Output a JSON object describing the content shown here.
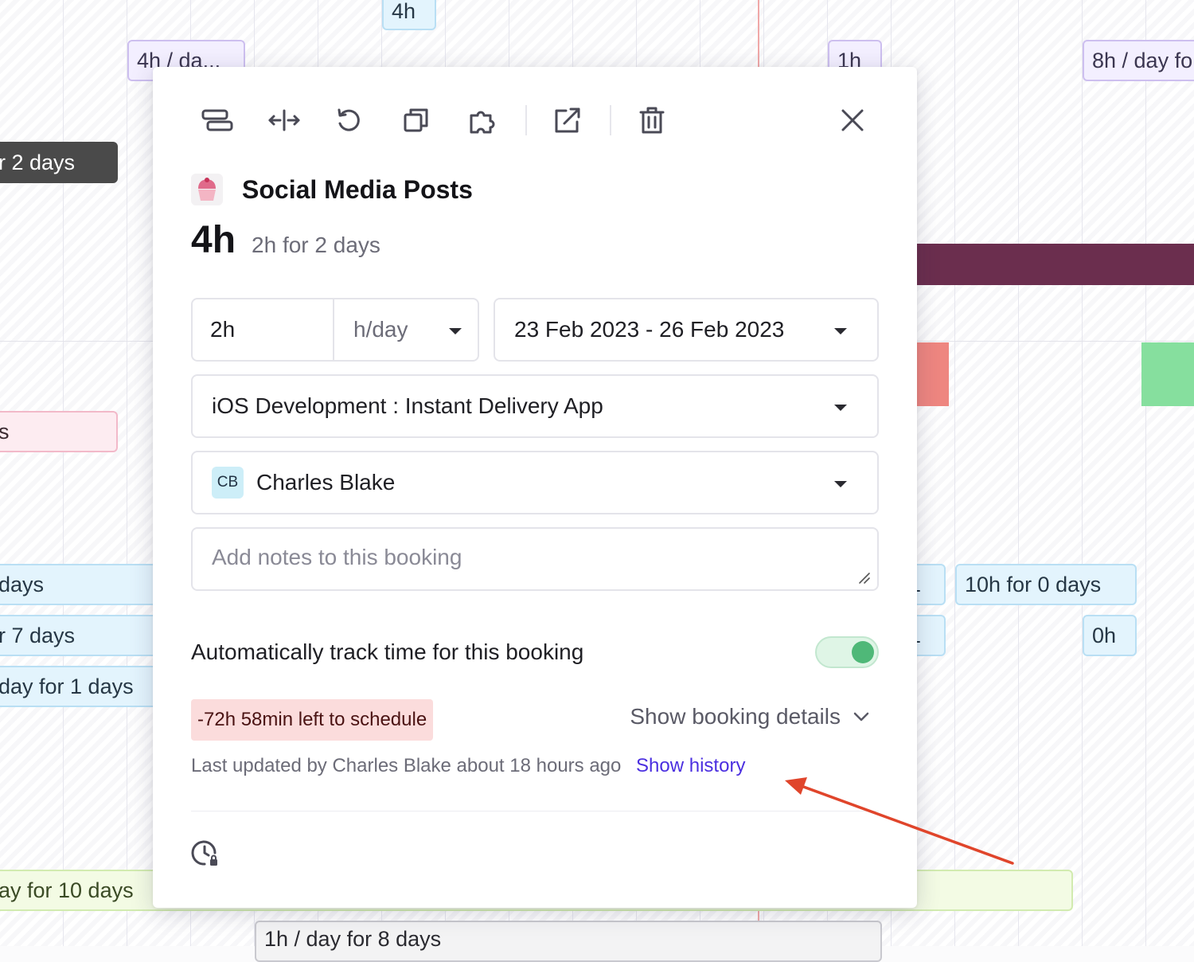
{
  "background_chips": [
    {
      "id": "c1",
      "text": "4h"
    },
    {
      "id": "c2",
      "text": "4h / da..."
    },
    {
      "id": "c3",
      "text": "1h"
    },
    {
      "id": "c4",
      "text": "8h / day fo"
    },
    {
      "id": "c5",
      "text": "r 2 days"
    },
    {
      "id": "c6",
      "text": "s"
    },
    {
      "id": "c7",
      "text": "days"
    },
    {
      "id": "c8",
      "text": "r 7 days"
    },
    {
      "id": "c9",
      "text": "day for 1 days"
    },
    {
      "id": "c10",
      "text": "1"
    },
    {
      "id": "c11",
      "text": "10h for 0 days"
    },
    {
      "id": "c12",
      "text": "1"
    },
    {
      "id": "c13",
      "text": "0h"
    },
    {
      "id": "c14",
      "text": "ay for 10 days"
    },
    {
      "id": "c15",
      "text": "1h / day for 8 days"
    }
  ],
  "toolbar": {
    "items": [
      {
        "name": "split-booking",
        "icon": "split-icon"
      },
      {
        "name": "resize-booking",
        "icon": "arrows-horizontal-icon"
      },
      {
        "name": "repeat-booking",
        "icon": "rotate-icon"
      },
      {
        "name": "duplicate-booking",
        "icon": "copy-icon"
      },
      {
        "name": "integration",
        "icon": "puzzle-icon"
      },
      {
        "name": "open-external",
        "icon": "external-link-icon"
      },
      {
        "name": "delete-booking",
        "icon": "trash-icon"
      }
    ],
    "close_icon": "close-icon"
  },
  "booking": {
    "project_icon": "cupcake-icon",
    "title": "Social Media Posts",
    "total_hours": "4h",
    "summary": "2h for 2 days",
    "hours_per_day_value": "2h",
    "hours_unit": "h/day",
    "date_range": "23 Feb 2023 - 26 Feb 2023",
    "project": "iOS Development : Instant Delivery App",
    "assignee_initials": "CB",
    "assignee_name": "Charles Blake",
    "notes_placeholder": "Add notes to this booking",
    "track_label": "Automatically track time for this booking",
    "track_enabled": true,
    "left_to_schedule": "-72h 58min left to schedule",
    "show_details_label": "Show booking details",
    "last_updated": "Last updated by Charles Blake about 18 hours ago",
    "show_history_label": "Show history"
  },
  "colors": {
    "accent_link": "#4b2fe0",
    "toggle_on": "#4fb878",
    "warning_bg": "#fbdcdc",
    "annotation_arrow": "#e0452b"
  }
}
